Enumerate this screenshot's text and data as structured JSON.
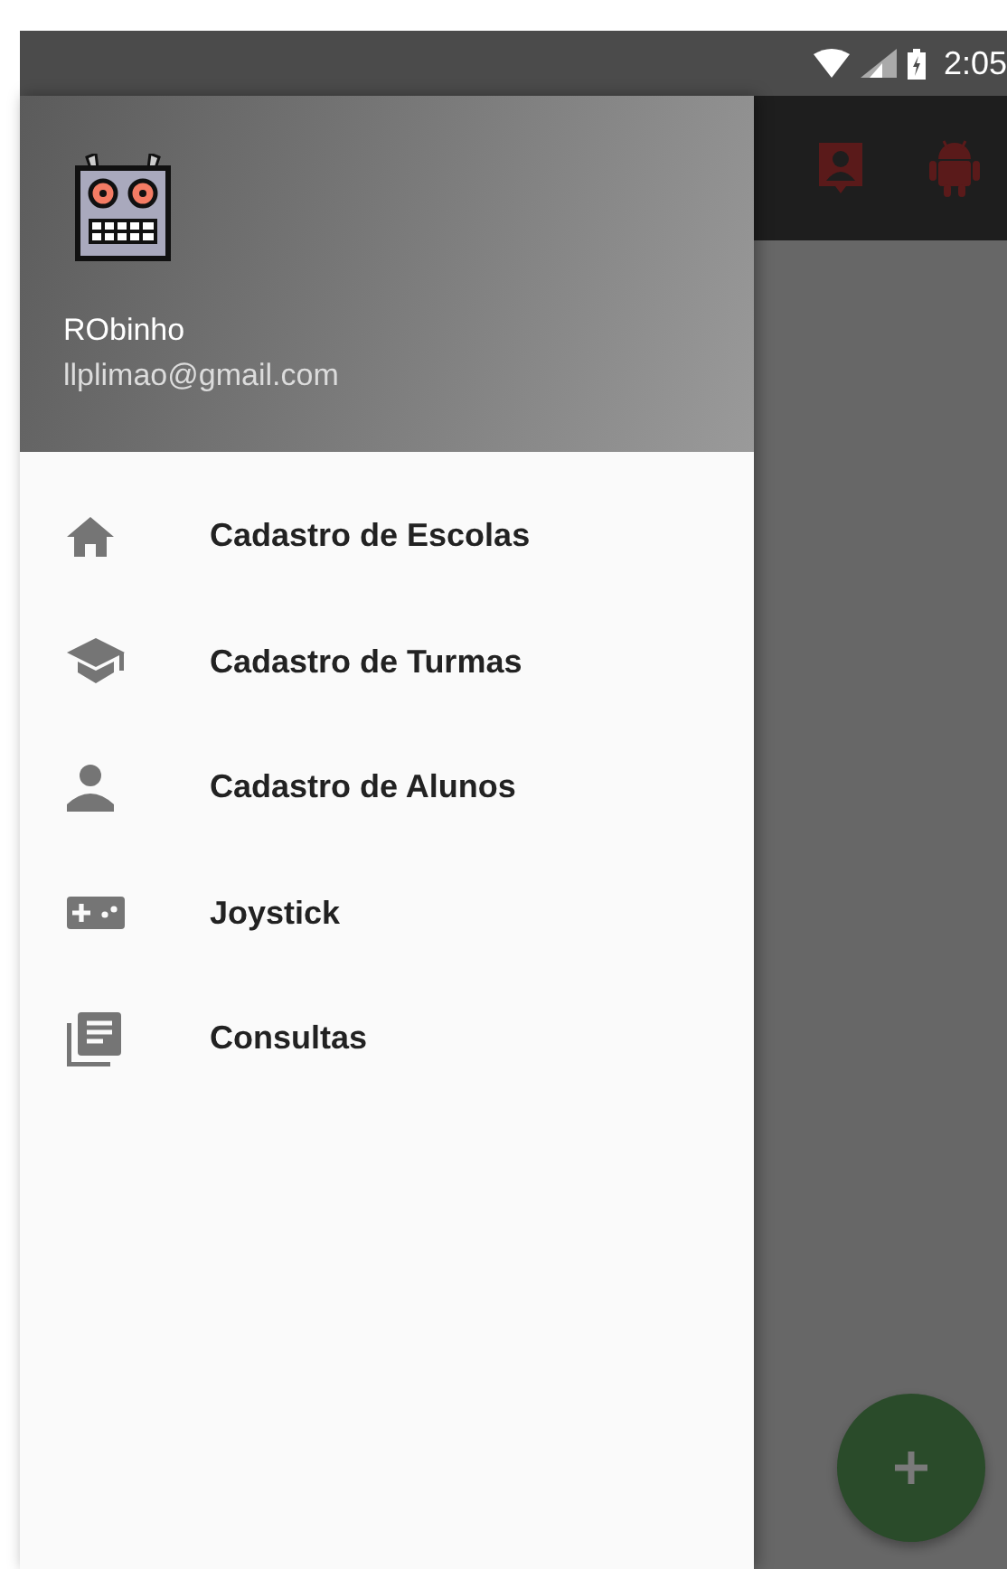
{
  "status_bar": {
    "time": "2:05"
  },
  "drawer": {
    "user_name": "RObinho",
    "user_email": "llplimao@gmail.com",
    "items": [
      {
        "label": "Cadastro de Escolas",
        "kind": "home"
      },
      {
        "label": "Cadastro de Turmas",
        "kind": "school"
      },
      {
        "label": "Cadastro de Alunos",
        "kind": "person"
      },
      {
        "label": "Joystick",
        "kind": "gamepad"
      },
      {
        "label": "Consultas",
        "kind": "library"
      }
    ]
  }
}
